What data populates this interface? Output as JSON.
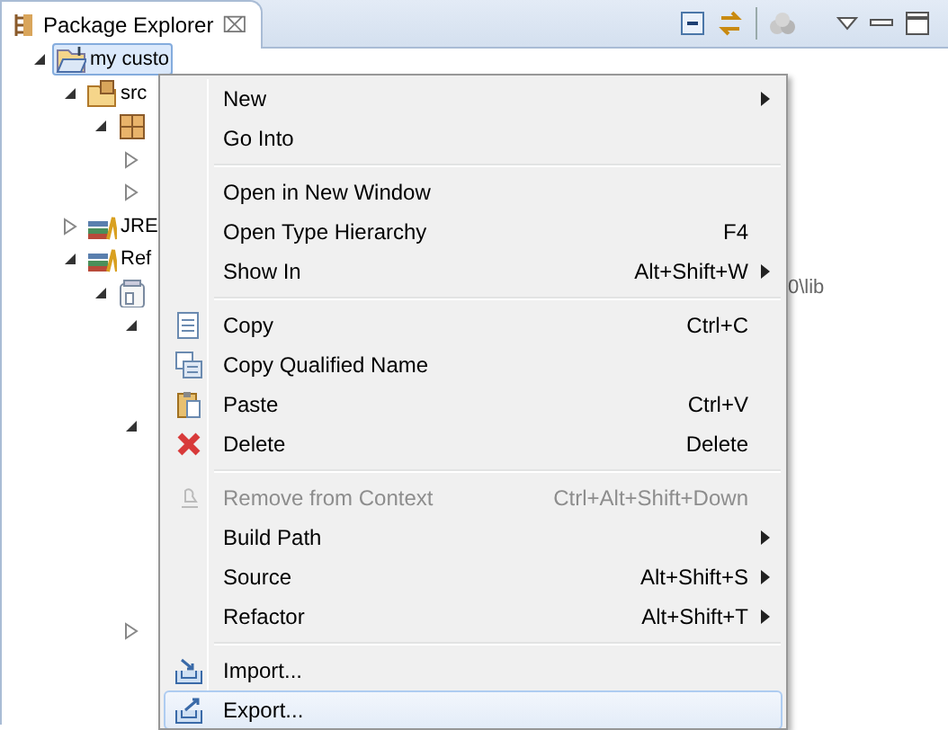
{
  "view_tab": {
    "title": "Package Explorer",
    "close": "⌧"
  },
  "tree": [
    {
      "label": "my custo",
      "kind": "project",
      "expanded": true,
      "selected": true,
      "children": [
        {
          "label": "src",
          "kind": "src",
          "expanded": true,
          "selected": false,
          "children": [
            {
              "kind": "package",
              "expanded": true,
              "selected": false,
              "children": [
                {
                  "expanded": false,
                  "selected": false
                },
                {
                  "expanded": false,
                  "selected": false
                }
              ]
            }
          ]
        },
        {
          "label": "JRE",
          "kind": "library",
          "expanded": false,
          "selected": false
        },
        {
          "label": "Ref",
          "kind": "library",
          "expanded": true,
          "selected": false,
          "children": [
            {
              "kind": "jar",
              "trailing": "0\\lib",
              "expanded": true,
              "selected": false,
              "children": [
                {
                  "expanded": true,
                  "selected": false
                },
                {
                  "expanded": true,
                  "selected": false
                },
                {
                  "expanded": false,
                  "selected": false
                }
              ]
            }
          ]
        }
      ]
    }
  ],
  "context_menu": [
    {
      "kind": "item",
      "label": "New",
      "submenu": true,
      "disabled": false,
      "selected": false
    },
    {
      "kind": "item",
      "label": "Go Into",
      "disabled": false,
      "selected": false
    },
    {
      "kind": "separator"
    },
    {
      "kind": "item",
      "label": "Open in New Window",
      "disabled": false,
      "selected": false
    },
    {
      "kind": "item",
      "label": "Open Type Hierarchy",
      "shortcut": "F4",
      "disabled": false,
      "selected": false
    },
    {
      "kind": "item",
      "label": "Show In",
      "shortcut": "Alt+Shift+W",
      "submenu": true,
      "disabled": false,
      "selected": false
    },
    {
      "kind": "separator"
    },
    {
      "kind": "copy",
      "label": "Copy",
      "shortcut": "Ctrl+C",
      "disabled": false,
      "selected": false
    },
    {
      "kind": "copy-qualified",
      "label": "Copy Qualified Name",
      "disabled": false,
      "selected": false
    },
    {
      "kind": "paste",
      "label": "Paste",
      "shortcut": "Ctrl+V",
      "disabled": false,
      "selected": false
    },
    {
      "kind": "delete",
      "label": "Delete",
      "shortcut": "Delete",
      "disabled": false,
      "selected": false
    },
    {
      "kind": "separator"
    },
    {
      "kind": "remove",
      "label": "Remove from Context",
      "shortcut": "Ctrl+Alt+Shift+Down",
      "disabled": true,
      "selected": false
    },
    {
      "kind": "item",
      "label": "Build Path",
      "submenu": true,
      "disabled": false,
      "selected": false
    },
    {
      "kind": "item",
      "label": "Source",
      "shortcut": "Alt+Shift+S",
      "submenu": true,
      "disabled": false,
      "selected": false
    },
    {
      "kind": "item",
      "label": "Refactor",
      "shortcut": "Alt+Shift+T",
      "submenu": true,
      "disabled": false,
      "selected": false
    },
    {
      "kind": "separator"
    },
    {
      "kind": "import",
      "label": "Import...",
      "disabled": false,
      "selected": false
    },
    {
      "kind": "export",
      "label": "Export...",
      "disabled": false,
      "selected": true
    }
  ]
}
